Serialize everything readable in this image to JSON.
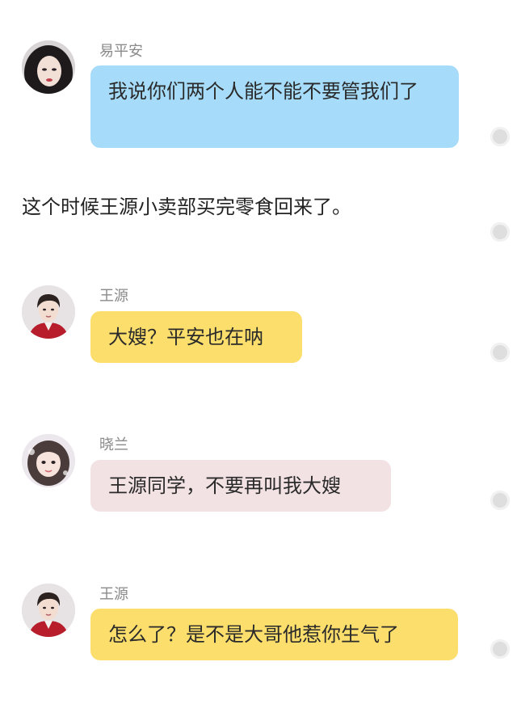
{
  "messages": [
    {
      "sender": "易平安",
      "text": "我说你们两个人能不能不要管我们了",
      "bubble_color": "#a6dcf9"
    },
    {
      "narration": "这个时候王源小卖部买完零食回来了。"
    },
    {
      "sender": "王源",
      "text": "大嫂？平安也在呐",
      "bubble_color": "#fbde6c"
    },
    {
      "sender": "晓兰",
      "text": "王源同学，不要再叫我大嫂",
      "bubble_color": "#f2e2e4"
    },
    {
      "sender": "王源",
      "text": "怎么了？是不是大哥他惹你生气了",
      "bubble_color": "#fbde6c"
    }
  ],
  "icons": {
    "avatar_1": "avatar-yipingan-icon",
    "avatar_2": "avatar-wangyuan-icon",
    "avatar_3": "avatar-xiaolan-icon",
    "side_action": "circle-dot-icon"
  }
}
